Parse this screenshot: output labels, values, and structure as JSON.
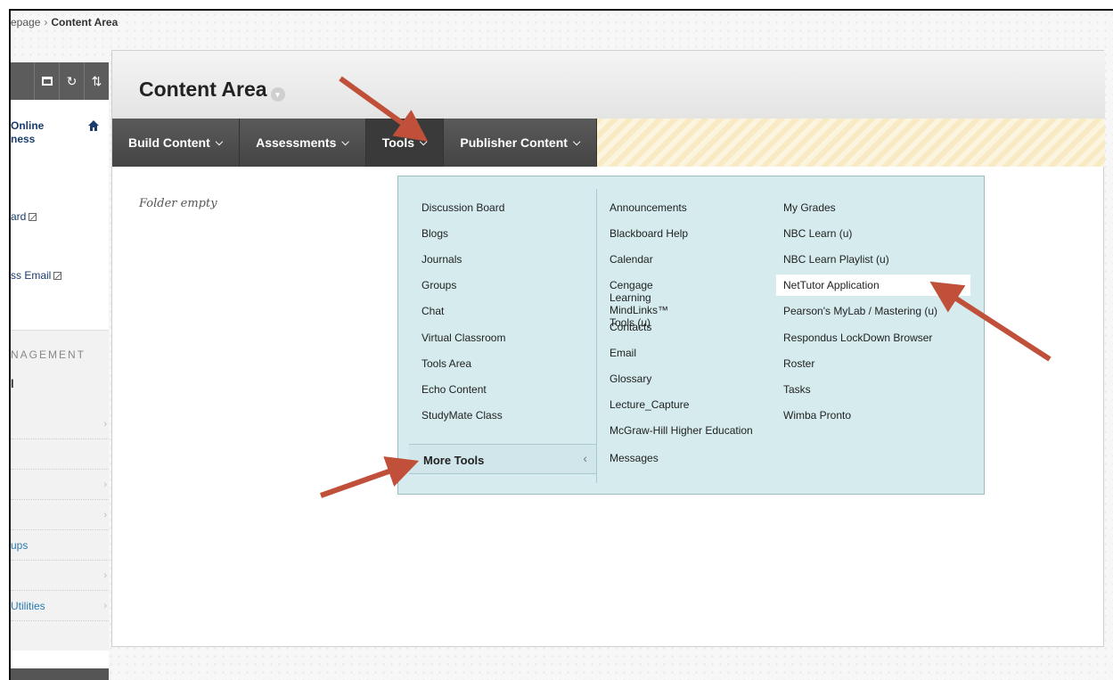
{
  "breadcrumb": {
    "prev": "epage",
    "separator": "›",
    "current": "Content Area"
  },
  "sidebar": {
    "toolbar_icons": [
      "display-icon",
      "refresh-icon",
      "sort-icon"
    ],
    "title": "Online\nness",
    "links": [
      {
        "label": "ard",
        "editable": true
      },
      {
        "label": "ss Email",
        "editable": true
      }
    ],
    "management": {
      "heading": "NAGEMENT",
      "subheading": "l",
      "rows": [
        "",
        "",
        "",
        "",
        "ups",
        "",
        "Utilities"
      ]
    }
  },
  "page": {
    "title": "Content Area",
    "menu": [
      {
        "label": "Build Content"
      },
      {
        "label": "Assessments"
      },
      {
        "label": "Tools"
      },
      {
        "label": "Publisher Content"
      }
    ],
    "empty_text": "Folder empty"
  },
  "tools_menu": {
    "col1": [
      "Discussion Board",
      "Blogs",
      "Journals",
      "Groups",
      "Chat",
      "Virtual Classroom",
      "Tools Area",
      "Echo Content",
      "StudyMate Class"
    ],
    "more_tools": "More Tools",
    "col2": [
      "Announcements",
      "Blackboard Help",
      "Calendar",
      "Cengage Learning MindLinks™\nTools (u)",
      "Contacts",
      "Email",
      "Glossary",
      "Lecture_Capture",
      "McGraw-Hill Higher Education",
      "Messages"
    ],
    "col3": [
      "My Grades",
      "NBC Learn (u)",
      "NBC Learn Playlist (u)",
      "NetTutor Application",
      "Pearson's MyLab / Mastering (u)",
      "Respondus LockDown Browser",
      "Roster",
      "Tasks",
      "Wimba Pronto"
    ],
    "highlighted": "NetTutor Application"
  },
  "colors": {
    "menu_bar": "#4a4a4a",
    "dropdown_bg": "#d5ebee",
    "arrow": "#c0503a",
    "link": "#1a3c6e"
  }
}
